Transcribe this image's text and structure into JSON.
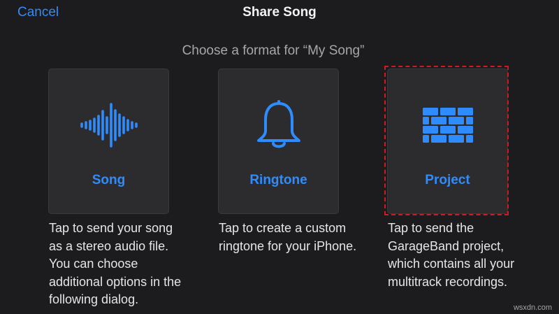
{
  "nav": {
    "cancel_label": "Cancel",
    "title": "Share Song"
  },
  "subtitle": "Choose a format for “My Song”",
  "options": [
    {
      "label": "Song",
      "icon": "waveform-icon",
      "description": "Tap to send your song as a stereo audio file. You can choose additional options in the following dialog."
    },
    {
      "label": "Ringtone",
      "icon": "bell-icon",
      "description": "Tap to create a custom ringtone for your iPhone."
    },
    {
      "label": "Project",
      "icon": "brick-wall-icon",
      "description": "Tap to send the GarageBand project, which contains all your multitrack recordings."
    }
  ],
  "watermark": "wsxdn.com",
  "colors": {
    "accent": "#2f8cff",
    "background": "#1c1c1e",
    "card": "#2c2c2e",
    "highlight": "#d21a22"
  }
}
